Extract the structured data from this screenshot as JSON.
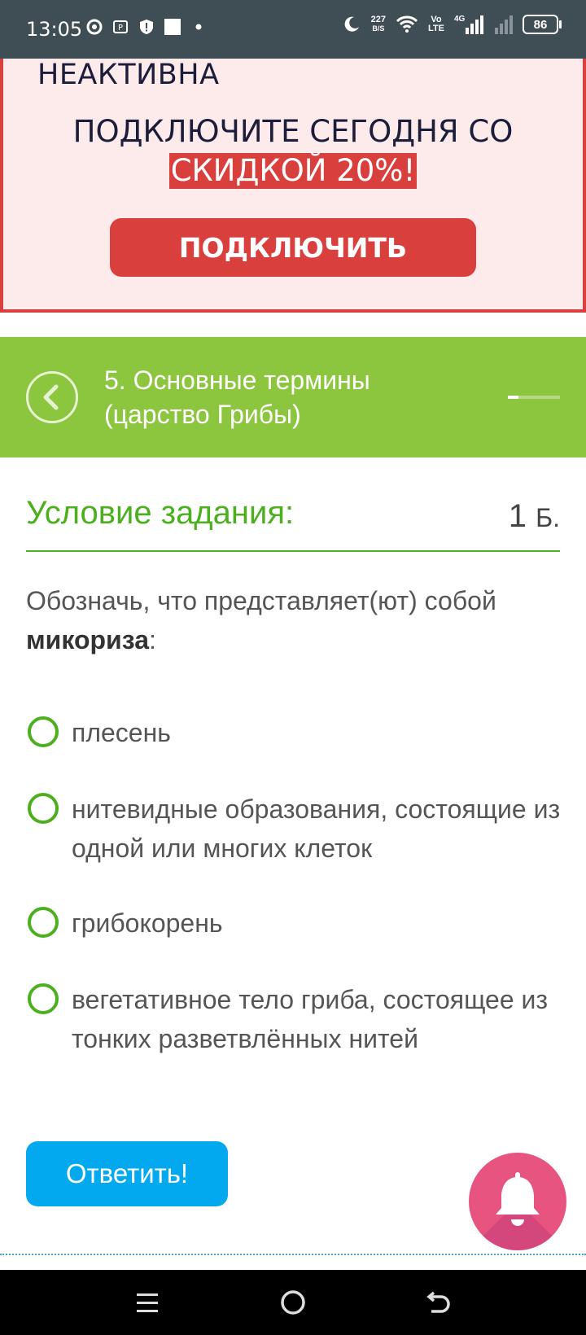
{
  "status_bar": {
    "time": "13:05",
    "net_speed_value": "227",
    "net_speed_unit": "B/S",
    "volte_top": "Vo",
    "volte_bottom": "LTE",
    "network": "4G",
    "battery": "86",
    "icons": [
      "chrome-icon",
      "parking-icon",
      "shield-alert-icon",
      "square-icon",
      "dot-icon",
      "moon-icon",
      "wifi-icon",
      "signal-icon",
      "signal-empty-icon",
      "battery-icon"
    ]
  },
  "promo": {
    "status_text": "НЕАКТИВНА",
    "line1": "ПОДКЛЮЧИТЕ СЕГОДНЯ СО",
    "line2": "СКИДКОЙ 20%!",
    "button_label": "ПОДКЛЮЧИТЬ",
    "accent_color": "#d9403d"
  },
  "topic": {
    "title": "5. Основные термины (царство Грибы)",
    "progress": 0.2,
    "color": "#8cc63f"
  },
  "task": {
    "header": "Условие задания:",
    "points_value": "1",
    "points_unit": "Б.",
    "question_before": "Обозначь, что представляет(ют) собой ",
    "question_bold": "микориза",
    "question_after": ":",
    "options": [
      "плесень",
      "нитевидные образования, состоящие из одной или многих клеток",
      "грибокорень",
      "вегетативное тело гриба, состоящее из тонких разветвлённых нитей"
    ],
    "answer_button": "Ответить!"
  },
  "nav": {
    "icons": [
      "menu-icon",
      "home-icon",
      "back-icon"
    ]
  }
}
